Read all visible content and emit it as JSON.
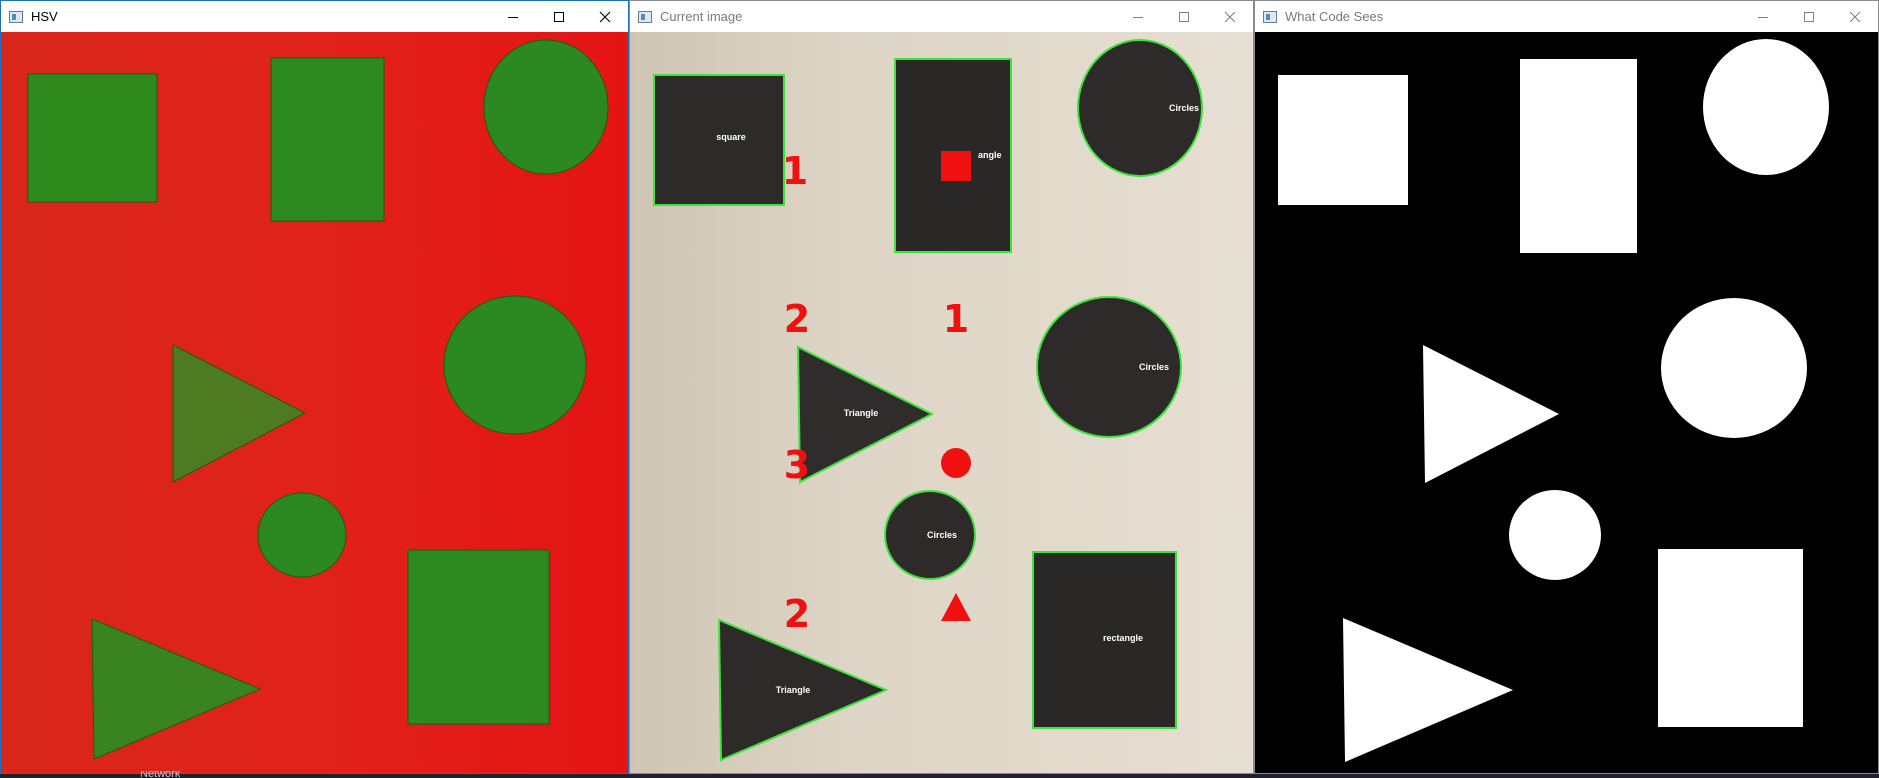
{
  "windows": [
    {
      "title": "HSV",
      "controls": {
        "minimize": "minimize-icon",
        "maximize": "maximize-icon",
        "close": "close-icon"
      }
    },
    {
      "title": "Current image",
      "controls": {
        "minimize": "minimize-icon",
        "maximize": "maximize-icon",
        "close": "close-icon"
      },
      "shape_labels": {
        "square": "square",
        "rectangle_partial": "angle",
        "circle_top": "Circles",
        "circle_mid": "Circles",
        "triangle_mid": "Triangle",
        "circle_small": "Circles",
        "triangle_bottom": "Triangle",
        "rectangle_bottom": "rectangle"
      },
      "count_markers": {
        "square_count": "1",
        "rect_count": "1",
        "triangle_count_a": "2",
        "circle_count": "3",
        "triangle_count_b": "2"
      }
    },
    {
      "title": "What Code Sees",
      "controls": {
        "minimize": "minimize-icon",
        "maximize": "maximize-icon",
        "close": "close-icon"
      }
    }
  ],
  "taskbar": {
    "label": "Network"
  },
  "colors": {
    "hsv_background": "#e01a14",
    "hsv_shape": "#2a8a1e",
    "paper": "#ddd3c3",
    "shape_dark": "#2c2828",
    "contour": "#37e33a",
    "marker": "#f01010",
    "mask_bg": "#000000",
    "mask_fg": "#ffffff"
  }
}
